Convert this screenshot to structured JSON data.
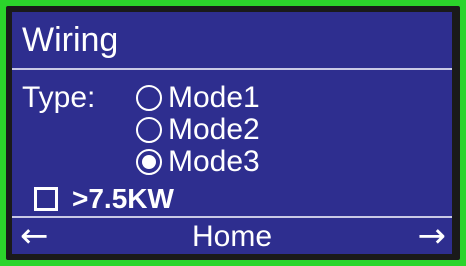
{
  "colors": {
    "screen_bg": "#2e2e8f",
    "border_green": "#2bd42b",
    "text": "#ffffff"
  },
  "header": {
    "title": "Wiring"
  },
  "type_selector": {
    "label": "Type:",
    "options": [
      {
        "label": "Mode1",
        "selected": false
      },
      {
        "label": "Mode2",
        "selected": false
      },
      {
        "label": "Mode3",
        "selected": true
      }
    ]
  },
  "power_option": {
    "label": ">7.5KW",
    "checked": false
  },
  "footer": {
    "left_icon": "arrow-left-icon",
    "home_label": "Home",
    "right_icon": "arrow-right-icon"
  }
}
